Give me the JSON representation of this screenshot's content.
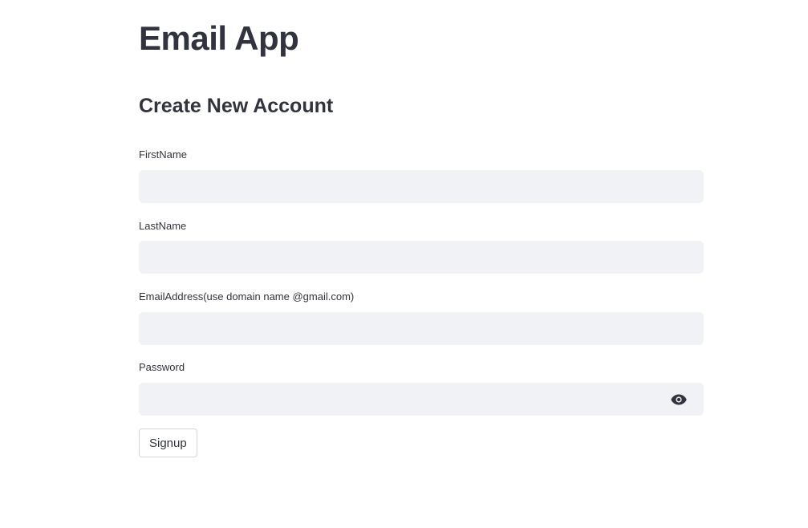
{
  "app": {
    "title": "Email App"
  },
  "form": {
    "heading": "Create New Account",
    "fields": [
      {
        "label": "FirstName",
        "value": "",
        "type": "text"
      },
      {
        "label": "LastName",
        "value": "",
        "type": "text"
      },
      {
        "label": "EmailAddress(use domain name @gmail.com)",
        "value": "",
        "type": "text"
      },
      {
        "label": "Password",
        "value": "",
        "type": "password",
        "icon": "eye-icon"
      }
    ],
    "submit_label": "Signup"
  },
  "colors": {
    "text": "#31333f",
    "input_background": "#f0f2f6",
    "button_border": "#d6d6d9",
    "page_background": "#ffffff"
  }
}
